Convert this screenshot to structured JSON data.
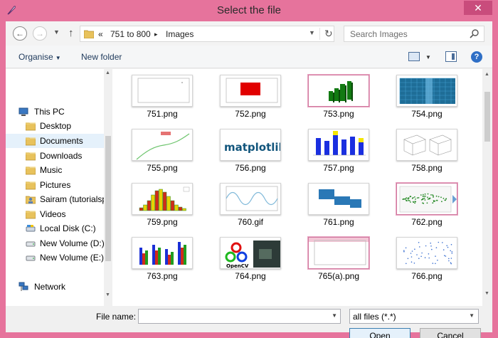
{
  "window": {
    "title": "Select the file",
    "close_glyph": "✕"
  },
  "nav": {
    "back_icon": "back-arrow-icon",
    "forward_icon": "forward-arrow-icon",
    "recent_icon": "chevron-down-icon",
    "up_icon": "up-arrow-icon"
  },
  "address": {
    "overflow": "«",
    "crumbs": [
      "751 to 800",
      "Images"
    ],
    "separator": "▸",
    "refresh_glyph": "↻"
  },
  "search": {
    "placeholder": "Search Images"
  },
  "toolbar": {
    "organise": "Organise",
    "organise_caret": "▼",
    "new_folder": "New folder",
    "help_glyph": "?"
  },
  "sidebar": {
    "items": [
      {
        "label": "This PC",
        "icon": "computer-icon",
        "level": 0
      },
      {
        "label": "Desktop",
        "icon": "folder-icon",
        "level": 1
      },
      {
        "label": "Documents",
        "icon": "folder-icon",
        "level": 1,
        "selected": true
      },
      {
        "label": "Downloads",
        "icon": "folder-icon",
        "level": 1
      },
      {
        "label": "Music",
        "icon": "folder-icon",
        "level": 1
      },
      {
        "label": "Pictures",
        "icon": "folder-icon",
        "level": 1
      },
      {
        "label": "Sairam (tutorialsp",
        "icon": "user-folder-icon",
        "level": 1
      },
      {
        "label": "Videos",
        "icon": "folder-icon",
        "level": 1
      },
      {
        "label": "Local Disk (C:)",
        "icon": "local-disk-icon",
        "level": 1
      },
      {
        "label": "New Volume (D:)",
        "icon": "drive-icon",
        "level": 1
      },
      {
        "label": "New Volume (E:)",
        "icon": "drive-icon",
        "level": 1
      },
      {
        "label": "Network",
        "icon": "network-icon",
        "level": 0
      }
    ]
  },
  "files": [
    {
      "name": "751.png",
      "thumb": "blank-plot"
    },
    {
      "name": "752.png",
      "thumb": "red-rect"
    },
    {
      "name": "753.png",
      "thumb": "green-3d-bars",
      "selected": true
    },
    {
      "name": "754.png",
      "thumb": "blue-grid"
    },
    {
      "name": "755.png",
      "thumb": "green-curve"
    },
    {
      "name": "756.png",
      "thumb": "matplotlib-logo"
    },
    {
      "name": "757.png",
      "thumb": "blue-yellow-bars"
    },
    {
      "name": "758.png",
      "thumb": "3d-plots"
    },
    {
      "name": "759.png",
      "thumb": "histogram"
    },
    {
      "name": "760.gif",
      "thumb": "sine-wave"
    },
    {
      "name": "761.png",
      "thumb": "step-blocks"
    },
    {
      "name": "762.png",
      "thumb": "scatter-green",
      "selected": true
    },
    {
      "name": "763.png",
      "thumb": "grouped-bars"
    },
    {
      "name": "764.png",
      "thumb": "opencv-logo"
    },
    {
      "name": "765(a).png",
      "thumb": "blank-plot-pink",
      "selected": true
    },
    {
      "name": "766.png",
      "thumb": "scatter-dots"
    }
  ],
  "logo_text": {
    "matplotlib": "matplotlib",
    "opencv": "OpenCV"
  },
  "bottom": {
    "file_name_label": "File name:",
    "file_name_value": "",
    "filter_value": "all files (*.*)",
    "open_label": "Open",
    "cancel_label": "Cancel"
  }
}
